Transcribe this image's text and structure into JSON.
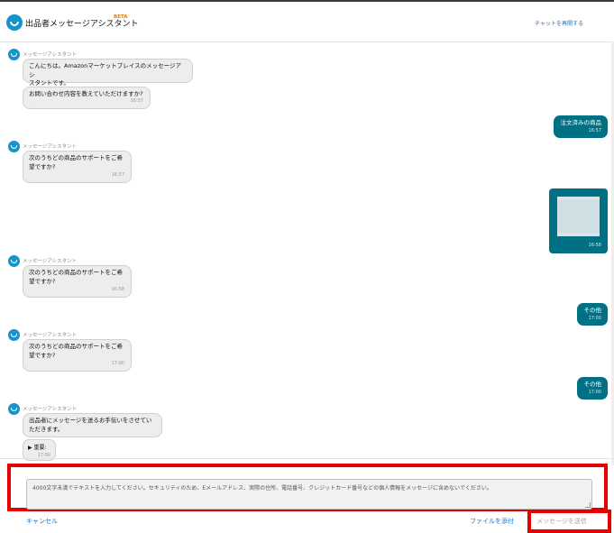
{
  "header": {
    "title": "出品者メッセージアシスタント",
    "beta": "BETA",
    "restart": "チャットを再開する"
  },
  "messages": [
    {
      "sender": "メッセージアシスタント",
      "lines": [
        "こんにちは。Amazonマーケットプレイスのメッセージアシ",
        "スタントです。"
      ]
    },
    {
      "lines": [
        "お問い合わせ内容を教えていただけますか?"
      ],
      "time": "16:57"
    },
    {
      "text": "注文済みの商品",
      "time": "16:57"
    },
    {
      "sender": "メッセージアシスタント",
      "lines": [
        "次のうちどの商品のサポートをご希",
        "望ですか?"
      ],
      "time": "16:57"
    },
    {
      "time": "16:58"
    },
    {
      "sender": "メッセージアシスタント",
      "lines": [
        "次のうちどの商品のサポートをご希",
        "望ですか?"
      ],
      "time": "16:58"
    },
    {
      "text": "その他",
      "time": "17:00"
    },
    {
      "sender": "メッセージアシスタント",
      "lines": [
        "次のうちどの商品のサポートをご希",
        "望ですか?"
      ],
      "time": "17:00"
    },
    {
      "text": "その他",
      "time": "17:00"
    },
    {
      "sender": "メッセージアシスタント",
      "lines": [
        "出品者にメッセージを送るお手伝いをさせてい",
        "ただきます。"
      ]
    },
    {
      "label": "▶ 重要:",
      "time": "17:00"
    }
  ],
  "input": {
    "placeholder": "4000文字未満でテキストを入力してください。セキュリティのため、Eメールアドレス、実際の住所、電話番号、クレジットカード番号などの個人情報をメッセージに含めないでください。"
  },
  "footer": {
    "cancel": "キャンセル",
    "attach": "ファイルを添付",
    "send": "メッセージを送信"
  },
  "colors": {
    "brand": "#1493cc",
    "outgoing_bubble": "#007185",
    "link": "#1874c4",
    "highlight": "#e60000"
  }
}
